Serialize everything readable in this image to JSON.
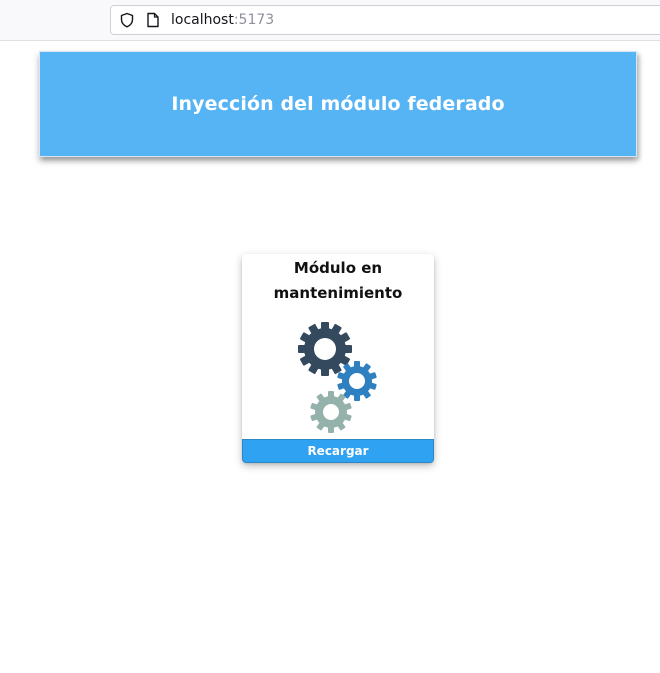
{
  "browser": {
    "url_host": "localhost",
    "url_port": ":5173",
    "icons": [
      "shield-icon",
      "page-icon"
    ]
  },
  "header": {
    "title": "Inyección del módulo federado",
    "background_color": "#56b4f5"
  },
  "card": {
    "title": "Módulo en mantenimiento",
    "image": "gears-icon",
    "button_label": "Recargar",
    "button_color": "#2fa2f1"
  }
}
